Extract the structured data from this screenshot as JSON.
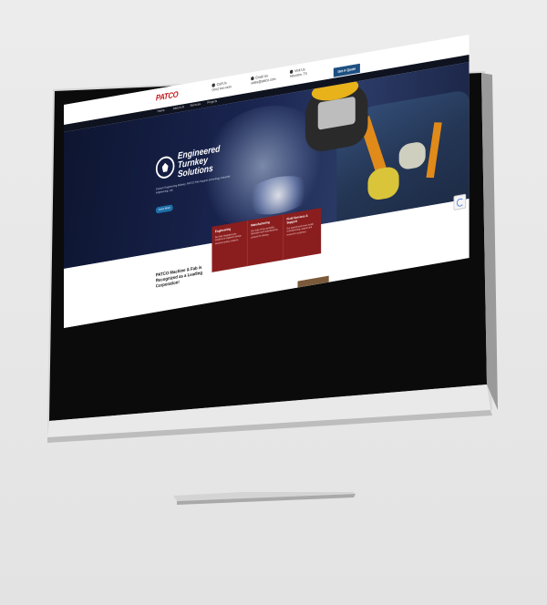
{
  "site": {
    "logo": "PATCO",
    "contacts": [
      {
        "icon": "phone-icon",
        "line1": "Call Us",
        "line2": "(xxx) xxx-xxxx"
      },
      {
        "icon": "mail-icon",
        "line1": "Email Us",
        "line2": "sales@patco.com"
      },
      {
        "icon": "location-icon",
        "line1": "Visit Us",
        "line2": "Houston, TX"
      }
    ],
    "quote_button": "Get A Quote",
    "nav": [
      "Home",
      "About Us",
      "Services",
      "Projects"
    ],
    "hero": {
      "title_lines": [
        "Engineered",
        "Turnkey",
        "Solutions"
      ],
      "subtitle": "Custom Engineering delivery. PATCO Fab Support technology industrial engineering, Ltd.",
      "button": "Learn More"
    },
    "lower": {
      "heading": "PATCO Machine & Fab is Recognized as a Leading Corporation!",
      "cards": [
        {
          "title": "Engineering",
          "text": "Our fully integrated pipe solutions to engineers design services turnkey solutions."
        },
        {
          "title": "Manufacturing",
          "text": "Our state-of-the-art facility fabrication and manufacturing projects for industry."
        },
        {
          "title": "Field Services & Support",
          "text": "Our experienced crews install commissioning, support and service for customers."
        }
      ]
    }
  },
  "colors": {
    "brand_red": "#c0161a",
    "nav_bg": "#0f1320",
    "button_blue": "#1d4f82",
    "card_red": "#8a1e1e"
  }
}
